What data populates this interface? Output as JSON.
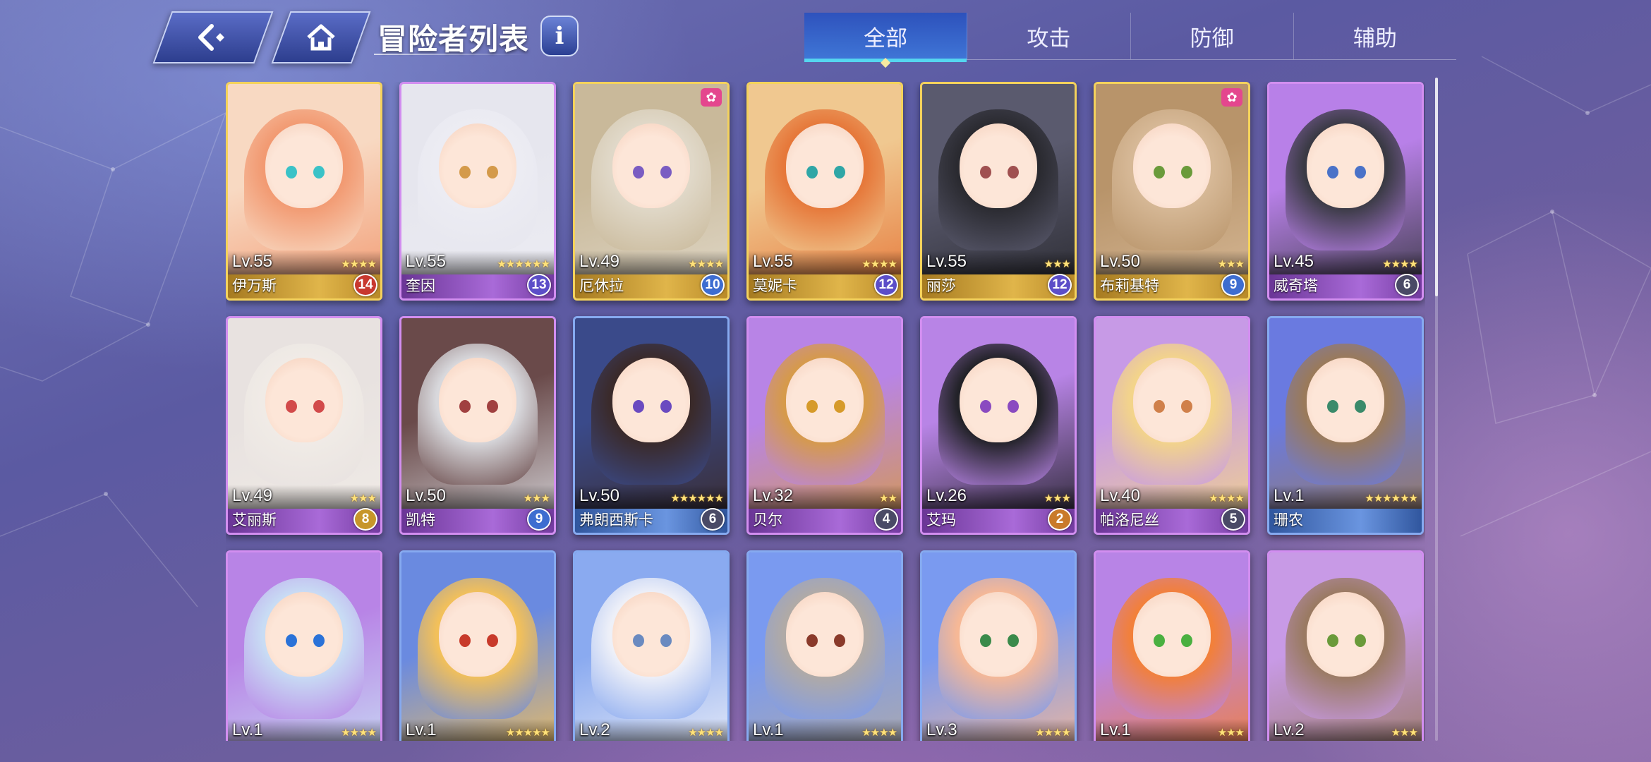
{
  "header": {
    "back_icon": "back-arrow-icon",
    "home_icon": "home-icon",
    "title": "冒险者列表",
    "info_label": "i"
  },
  "tabs": [
    {
      "label": "全部",
      "active": true
    },
    {
      "label": "攻击",
      "active": false
    },
    {
      "label": "防御",
      "active": false
    },
    {
      "label": "辅助",
      "active": false
    }
  ],
  "cards": [
    {
      "level": "Lv.55",
      "name": "伊万斯",
      "stars": 4,
      "count": "14",
      "rarity": "gold",
      "badge": "red",
      "paw": false
    },
    {
      "level": "Lv.55",
      "name": "奎因",
      "stars": 6,
      "count": "13",
      "rarity": "purple",
      "badge": "purple",
      "paw": false
    },
    {
      "level": "Lv.49",
      "name": "厄休拉",
      "stars": 4,
      "count": "10",
      "rarity": "gold",
      "badge": "blue",
      "paw": true
    },
    {
      "level": "Lv.55",
      "name": "莫妮卡",
      "stars": 4,
      "count": "12",
      "rarity": "gold",
      "badge": "purple",
      "paw": false
    },
    {
      "level": "Lv.55",
      "name": "丽莎",
      "stars": 3,
      "count": "12",
      "rarity": "gold",
      "badge": "purple",
      "paw": false
    },
    {
      "level": "Lv.50",
      "name": "布莉基特",
      "stars": 3,
      "count": "9",
      "rarity": "gold",
      "badge": "blue",
      "paw": true
    },
    {
      "level": "Lv.45",
      "name": "威奇塔",
      "stars": 4,
      "count": "6",
      "rarity": "purple",
      "badge": "gray",
      "paw": false
    },
    {
      "level": "Lv.49",
      "name": "艾丽斯",
      "stars": 3,
      "count": "8",
      "rarity": "purple",
      "badge": "gold",
      "paw": false
    },
    {
      "level": "Lv.50",
      "name": "凯特",
      "stars": 3,
      "count": "9",
      "rarity": "purple",
      "badge": "blue",
      "paw": false
    },
    {
      "level": "Lv.50",
      "name": "弗朗西斯卡",
      "stars": 6,
      "count": "6",
      "rarity": "blue",
      "badge": "gray",
      "paw": false
    },
    {
      "level": "Lv.32",
      "name": "贝尔",
      "stars": 2,
      "count": "4",
      "rarity": "purple",
      "badge": "gray",
      "paw": false
    },
    {
      "level": "Lv.26",
      "name": "艾玛",
      "stars": 3,
      "count": "2",
      "rarity": "purple",
      "badge": "orange",
      "paw": false
    },
    {
      "level": "Lv.40",
      "name": "帕洛尼丝",
      "stars": 4,
      "count": "5",
      "rarity": "purple",
      "badge": "gray",
      "paw": false
    },
    {
      "level": "Lv.1",
      "name": "珊农",
      "stars": 6,
      "count": "",
      "rarity": "blue",
      "badge": "",
      "paw": false
    },
    {
      "level": "Lv.1",
      "name": "",
      "stars": 4,
      "count": "",
      "rarity": "purple",
      "badge": "",
      "paw": false
    },
    {
      "level": "Lv.1",
      "name": "",
      "stars": 5,
      "count": "",
      "rarity": "blue",
      "badge": "",
      "paw": false
    },
    {
      "level": "Lv.2",
      "name": "",
      "stars": 4,
      "count": "",
      "rarity": "blue",
      "badge": "",
      "paw": false
    },
    {
      "level": "Lv.1",
      "name": "",
      "stars": 4,
      "count": "",
      "rarity": "blue",
      "badge": "",
      "paw": false
    },
    {
      "level": "Lv.3",
      "name": "",
      "stars": 4,
      "count": "",
      "rarity": "blue",
      "badge": "",
      "paw": false
    },
    {
      "level": "Lv.1",
      "name": "",
      "stars": 3,
      "count": "",
      "rarity": "purple",
      "badge": "",
      "paw": false
    },
    {
      "level": "Lv.2",
      "name": "",
      "stars": 3,
      "count": "",
      "rarity": "purple",
      "badge": "",
      "paw": false
    }
  ],
  "art_palettes": [
    [
      "#f8d9c2",
      "#f29a72",
      "#3ac2c7"
    ],
    [
      "#e6e6ee",
      "#ececf3",
      "#d49a4a"
    ],
    [
      "#c9b99a",
      "#e0d8c8",
      "#7a5cc2"
    ],
    [
      "#f0c890",
      "#e6783a",
      "#2fa6a6"
    ],
    [
      "#5a5a6e",
      "#2a2a30",
      "#a05050"
    ],
    [
      "#b8946a",
      "#d6b896",
      "#6a9a3a"
    ],
    [
      "#b880e8",
      "#3a3a44",
      "#4a72c8"
    ],
    [
      "#e8e2e0",
      "#f0ebe6",
      "#d24a4a"
    ],
    [
      "#6a4a4a",
      "#d8d8dc",
      "#a04040"
    ],
    [
      "#3a4a8a",
      "#3a2a2a",
      "#6a4ac0"
    ],
    [
      "#b884e6",
      "#d69a4a",
      "#d69a2a"
    ],
    [
      "#b884e6",
      "#222228",
      "#8a4ac0"
    ],
    [
      "#c79ae6",
      "#f3d48a",
      "#d0804a"
    ],
    [
      "#6a7ae0",
      "#9a7a5a",
      "#3a8a6a"
    ],
    [
      "#b884e6",
      "#c8dcf4",
      "#2a72d8"
    ],
    [
      "#6a8ae0",
      "#f2c05a",
      "#c83a2a"
    ],
    [
      "#8aaaf0",
      "#eef0f8",
      "#6a8ac0"
    ],
    [
      "#7a9af0",
      "#b0aaa6",
      "#8a3a2a"
    ],
    [
      "#7a9af0",
      "#f6b896",
      "#3a8a4a"
    ],
    [
      "#b884e6",
      "#f2803a",
      "#4ab040"
    ],
    [
      "#c89ae6",
      "#9a7a62",
      "#6a9a3a"
    ]
  ]
}
